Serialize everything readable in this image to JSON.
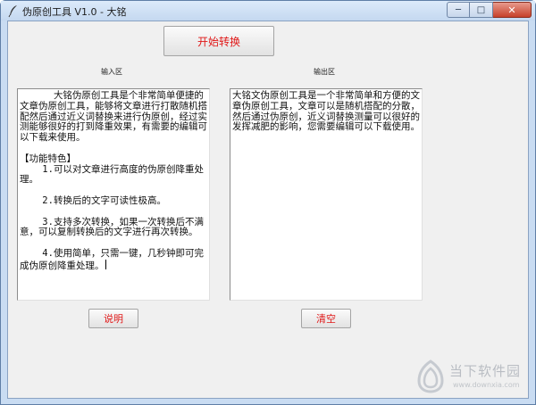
{
  "window": {
    "title": "伪原创工具 V1.0 - 大铭",
    "min_label": "─",
    "max_label": "□",
    "close_label": "✕"
  },
  "toolbar": {
    "start_label": "开始转换"
  },
  "input": {
    "label": "输入区",
    "text": "      大铭伪原创工具是个非常简单便捷的文章伪原创工具，能够将文章进行打散随机搭配然后通过近义词替换来进行伪原创，经过实测能够很好的打到降重效果，有需要的编辑可以下载来使用。\n\n【功能特色】\n    1.可以对文章进行高度的伪原创降重处理。\n\n    2.转换后的文字可读性极高。\n\n    3.支持多次转换，如果一次转换后不满意，可以复制转换后的文字进行再次转换。\n\n    4.使用简单，只需一键，几秒钟即可完成伪原创降重处理。"
  },
  "output": {
    "label": "输出区",
    "text": "大铭文伪原创工具是一个非常简单和方便的文章伪原创工具，文章可以是随机搭配的分散，然后通过伪原创，近义词替换测量可以很好的发挥减肥的影响，您需要编辑可以下载使用。"
  },
  "footer": {
    "help_label": "说明",
    "clear_label": "清空"
  },
  "watermark": {
    "title": "当下软件园",
    "url": "www.downxia.com"
  },
  "colors": {
    "accent_text": "#e01818",
    "frame": "#c9dcf2",
    "client_bg": "#f0f0f0"
  }
}
